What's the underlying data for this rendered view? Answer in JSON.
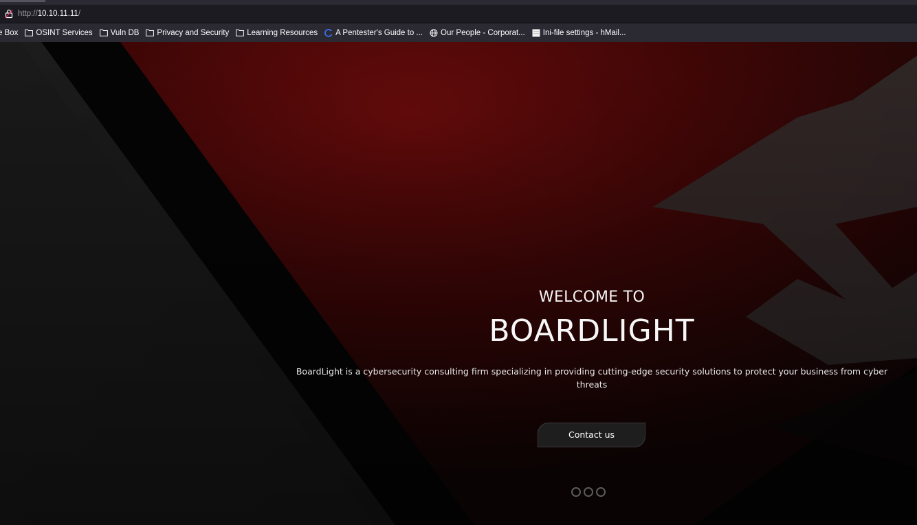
{
  "browser": {
    "url_protocol": "http://",
    "url_host": "10.10.11.11",
    "url_path": "/",
    "bookmarks": [
      {
        "label": "e Box",
        "icon": "none"
      },
      {
        "label": "OSINT Services",
        "icon": "folder-icon"
      },
      {
        "label": "Vuln DB",
        "icon": "folder-icon"
      },
      {
        "label": "Privacy and Security",
        "icon": "folder-icon"
      },
      {
        "label": "Learning Resources",
        "icon": "folder-icon"
      },
      {
        "label": "A Pentester's Guide to ...",
        "icon": "loading-spinner-icon"
      },
      {
        "label": "Our People - Corporat...",
        "icon": "globe-icon"
      },
      {
        "label": "Ini-file settings - hMail...",
        "icon": "page-icon"
      }
    ]
  },
  "hero": {
    "welcome": "WELCOME TO",
    "brand": "BOARDLIGHT",
    "description": "BoardLight is a cybersecurity consulting firm specializing in providing cutting-edge security solutions to protect your business from cyber threats",
    "cta_label": "Contact us",
    "slide_count": 3
  },
  "colors": {
    "hero_red": "#6b0c0c",
    "dark_panel": "#1d1d1d",
    "button_bg": "#1e1e1e"
  }
}
